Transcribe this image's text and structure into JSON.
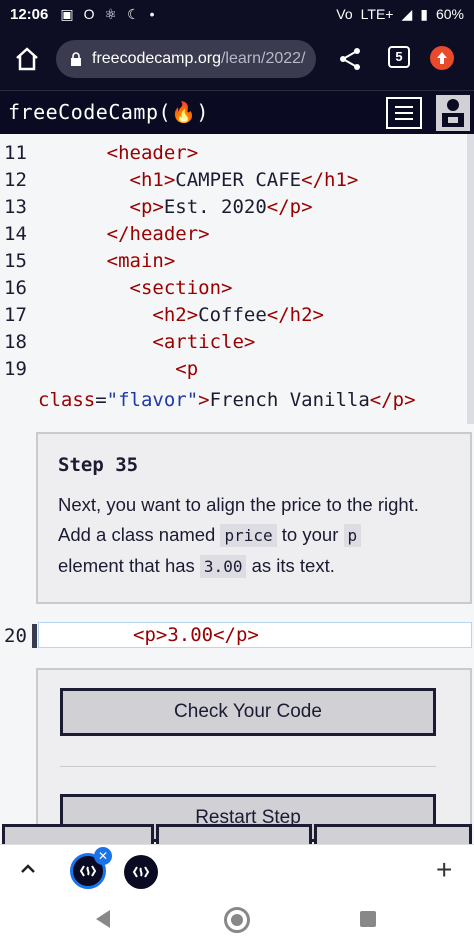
{
  "status_bar": {
    "time": "12:06",
    "network": "LTE+",
    "battery": "60%"
  },
  "browser": {
    "url_host": "freecodecamp.org",
    "url_path": "/learn/2022/",
    "tab_count": "5"
  },
  "fcc_nav": {
    "logo": "freeCodeCamp(🔥)"
  },
  "code_lines": [
    {
      "num": "11",
      "indent": "      ",
      "parts": [
        [
          "tag",
          "<header>"
        ]
      ]
    },
    {
      "num": "12",
      "indent": "        ",
      "parts": [
        [
          "tag",
          "<h1>"
        ],
        [
          "text",
          "CAMPER CAFE"
        ],
        [
          "tag",
          "</h1>"
        ]
      ]
    },
    {
      "num": "13",
      "indent": "        ",
      "parts": [
        [
          "tag",
          "<p>"
        ],
        [
          "text",
          "Est. 2020"
        ],
        [
          "tag",
          "</p>"
        ]
      ]
    },
    {
      "num": "14",
      "indent": "      ",
      "parts": [
        [
          "tag",
          "</header>"
        ]
      ]
    },
    {
      "num": "15",
      "indent": "      ",
      "parts": [
        [
          "tag",
          "<main>"
        ]
      ]
    },
    {
      "num": "16",
      "indent": "        ",
      "parts": [
        [
          "tag",
          "<section>"
        ]
      ]
    },
    {
      "num": "17",
      "indent": "          ",
      "parts": [
        [
          "tag",
          "<h2>"
        ],
        [
          "text",
          "Coffee"
        ],
        [
          "tag",
          "</h2>"
        ]
      ]
    },
    {
      "num": "18",
      "indent": "          ",
      "parts": [
        [
          "tag",
          "<article>"
        ]
      ]
    },
    {
      "num": "19",
      "indent": "            ",
      "parts": [
        [
          "tag",
          "<p"
        ]
      ]
    },
    {
      "num": "",
      "indent": "",
      "parts": [
        [
          "attr",
          "class"
        ],
        [
          "text",
          "="
        ],
        [
          "str",
          "\"flavor\""
        ],
        [
          "tag",
          ">"
        ],
        [
          "text",
          "French Vanilla"
        ],
        [
          "tag",
          "</p>"
        ]
      ]
    }
  ],
  "step": {
    "title": "Step 35",
    "text_1": "Next, you want to align the price to the right. Add a class named ",
    "code_1": "price",
    "text_2": " to your ",
    "code_2": "p",
    "text_3": " element that has ",
    "code_3": "3.00",
    "text_4": " as its text."
  },
  "editable_line": {
    "num": "20",
    "code": "<p>3.00</p>"
  },
  "actions": {
    "check": "Check Your Code",
    "restart": "Restart Step"
  }
}
